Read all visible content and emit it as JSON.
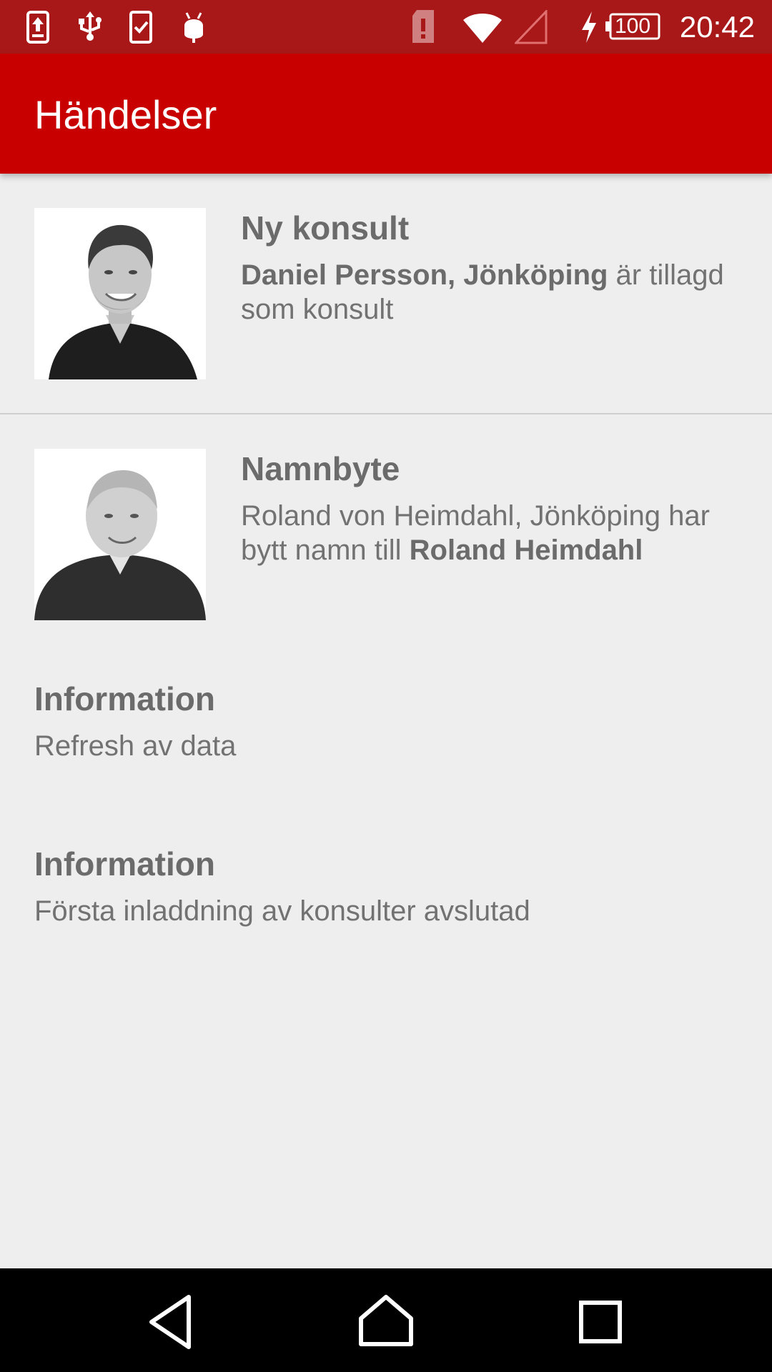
{
  "status_bar": {
    "time": "20:42",
    "battery_level": "100",
    "icons": [
      "upload-icon",
      "usb-icon",
      "clipboard-check-icon",
      "android-debug-icon",
      "sim-alert-icon",
      "wifi-icon",
      "cell-signal-icon",
      "charging-icon",
      "battery-icon"
    ]
  },
  "app_bar": {
    "title": "Händelser"
  },
  "events": [
    {
      "title": "Ny konsult",
      "desc_bold": "Daniel Persson, Jönköping",
      "desc_rest": " är tillagd som konsult",
      "photo": "avatar"
    },
    {
      "title": "Namnbyte",
      "desc_plain": "Roland von Heimdahl, Jönköping har bytt namn till ",
      "desc_bold": "Roland Heimdahl",
      "photo": "avatar"
    }
  ],
  "info_items": [
    {
      "title": "Information",
      "desc": "Refresh av data"
    },
    {
      "title": "Information",
      "desc": "Första inladdning av konsulter avslutad"
    }
  ],
  "nav_bar": {
    "icons": [
      "back-icon",
      "home-icon",
      "recents-icon"
    ]
  },
  "colors": {
    "status_bar": "#a81818",
    "app_bar": "#c80000",
    "background": "#eeeeee",
    "text": "#6b6b6b"
  }
}
